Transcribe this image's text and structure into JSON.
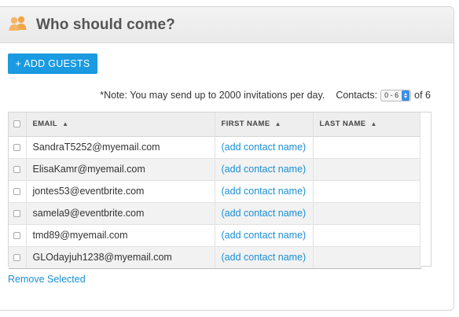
{
  "header": {
    "title": "Who should come?",
    "icon": "people-icon",
    "icon_color": "#f0a64a"
  },
  "toolbar": {
    "add_guests_label": "+ ADD GUESTS"
  },
  "note": {
    "text": "*Note: You may send up to 2000 invitations per day.",
    "contacts_label": "Contacts:",
    "range_value": "0 - 6",
    "of_label": "of 6"
  },
  "table": {
    "columns": [
      {
        "label": "EMAIL",
        "sort": "▲"
      },
      {
        "label": "FIRST NAME",
        "sort": "▲"
      },
      {
        "label": "LAST NAME",
        "sort": "▲"
      }
    ],
    "rows": [
      {
        "email": "SandraT5252@myemail.com",
        "first_name": "(add contact name)",
        "last_name": ""
      },
      {
        "email": "ElisaKamr@myemail.com",
        "first_name": "(add contact name)",
        "last_name": ""
      },
      {
        "email": "jontes53@eventbrite.com",
        "first_name": "(add contact name)",
        "last_name": ""
      },
      {
        "email": "samela9@eventbrite.com",
        "first_name": "(add contact name)",
        "last_name": ""
      },
      {
        "email": "tmd89@myemail.com",
        "first_name": "(add contact name)",
        "last_name": ""
      },
      {
        "email": "GLOdayjuh1238@myemail.com",
        "first_name": "(add contact name)",
        "last_name": ""
      }
    ]
  },
  "footer": {
    "remove_selected_label": "Remove Selected"
  },
  "colors": {
    "accent": "#1a9ae0",
    "link": "#1a8fd6",
    "header_bg": "#eeeeee"
  }
}
